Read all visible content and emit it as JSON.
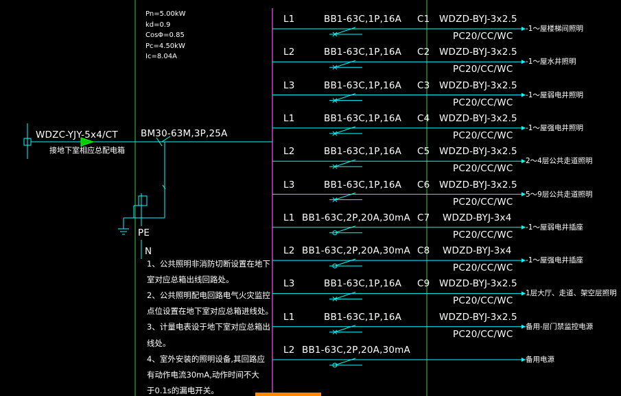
{
  "panel_params": [
    "Pn=5.00kW",
    "kd=0.9",
    "CosΦ=0.85",
    "Pc=4.50kW",
    "Ic=8.04A"
  ],
  "incoming": {
    "cable": "WDZC-YJY-5x4/CT",
    "desc": "接地下室相应总配电箱",
    "breaker": "BM30-63M,3P,25A"
  },
  "pe_label": "PE",
  "n_label": "N",
  "notes": [
    "1、公共照明非消防切断设置在地下",
    "室对应总箱出线回路处。",
    "2、公共照明配电回路电气火灾监控",
    "点位设置在地下室对应总箱进线处。",
    "3、计量电表设于地下室对应总箱出",
    "线处。",
    "4、室外安装的照明设备,其回路应",
    "有动作电流30mA,动作时间不大",
    "于0.1s的漏电开关。"
  ],
  "circuits": [
    {
      "phase": "L1",
      "breaker": "BB1-63C,1P,16A",
      "id": "C1",
      "cable": "WDZD-BYJ-3x2.5",
      "conduit": "PC20/CC/WC",
      "load": "-1～屋楼梯间照明",
      "rcd": false
    },
    {
      "phase": "L2",
      "breaker": "BB1-63C,1P,16A",
      "id": "C2",
      "cable": "WDZD-BYJ-3x2.5",
      "conduit": "PC20/CC/WC",
      "load": "-1～屋水井照明",
      "rcd": false
    },
    {
      "phase": "L3",
      "breaker": "BB1-63C,1P,16A",
      "id": "C3",
      "cable": "WDZD-BYJ-3x2.5",
      "conduit": "PC20/CC/WC",
      "load": "-1～屋弱电井照明",
      "rcd": false
    },
    {
      "phase": "L1",
      "breaker": "BB1-63C,1P,16A",
      "id": "C4",
      "cable": "WDZD-BYJ-3x2.5",
      "conduit": "PC20/CC/WC",
      "load": "-1～屋强电井照明",
      "rcd": false
    },
    {
      "phase": "L2",
      "breaker": "BB1-63C,1P,16A",
      "id": "C5",
      "cable": "WDZD-BYJ-3x2.5",
      "conduit": "PC20/CC/WC",
      "load": "2～4层公共走道照明",
      "rcd": false
    },
    {
      "phase": "L3",
      "breaker": "BB1-63C,1P,16A",
      "id": "C6",
      "cable": "WDZD-BYJ-3x2.5",
      "conduit": "PC20/CC/WC",
      "load": "5～9层公共走道照明",
      "rcd": false
    },
    {
      "phase": "L1",
      "breaker": "BB1-63C,2P,20A,30mA",
      "id": "C7",
      "cable": "WDZD-BYJ-3x4",
      "conduit": "PC20/CC/WC",
      "load": "-1～屋弱电井插座",
      "rcd": true
    },
    {
      "phase": "L2",
      "breaker": "BB1-63C,2P,20A,30mA",
      "id": "C8",
      "cable": "WDZD-BYJ-3x4",
      "conduit": "PC20/CC/WC",
      "load": "-1～屋强电井插座",
      "rcd": true
    },
    {
      "phase": "L3",
      "breaker": "BB1-63C,1P,16A",
      "id": "C9",
      "cable": "WDZD-BYJ-3x2.5",
      "conduit": "PC20/CC/WC",
      "load": "1层大厅、走道、架空层照明",
      "rcd": false
    },
    {
      "phase": "L1",
      "breaker": "BB1-63C,1P,16A",
      "id": "",
      "cable": "WDZD-BYJ-3x2.5",
      "conduit": "PC20/CC/WC",
      "load": "备用-层门禁监控电源",
      "rcd": false
    },
    {
      "phase": "L2",
      "breaker": "BB1-63C,2P,20A,30mA",
      "id": "",
      "cable": "",
      "conduit": "",
      "load": "备用电源",
      "rcd": true
    }
  ],
  "colors": {
    "background": "#000000",
    "wire": "#00ffff",
    "box": "#33cc33",
    "busbar": "#cc44cc",
    "text": "#ffffff",
    "accent": "#ff8800"
  }
}
